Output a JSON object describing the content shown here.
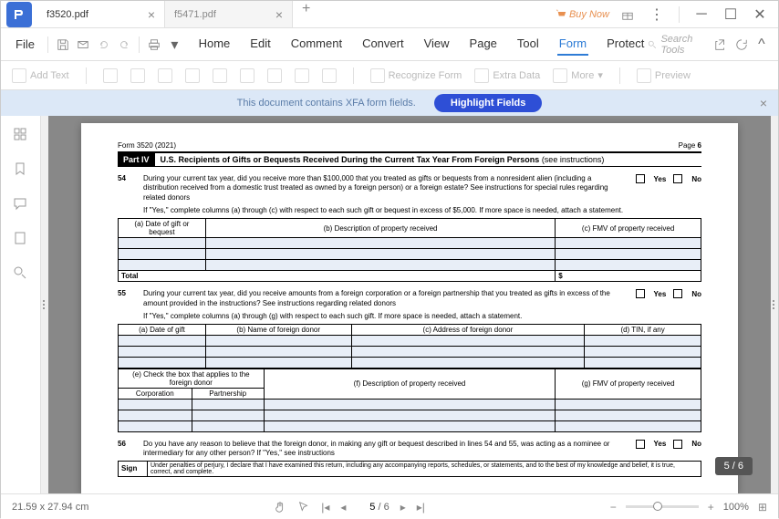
{
  "titlebar": {
    "tabs": [
      {
        "name": "f3520.pdf",
        "active": true
      },
      {
        "name": "f5471.pdf",
        "active": false
      }
    ],
    "buy_now": "Buy Now"
  },
  "menubar": {
    "file": "File",
    "tabs": [
      "Home",
      "Edit",
      "Comment",
      "Convert",
      "View",
      "Page",
      "Tool",
      "Form",
      "Protect"
    ],
    "active_tab": "Form",
    "search_placeholder": "Search Tools"
  },
  "toolbar": {
    "add_text": "Add Text",
    "recognize_form": "Recognize Form",
    "extra_data": "Extra Data",
    "more": "More",
    "preview": "Preview"
  },
  "xfa": {
    "message": "This document contains XFA form fields.",
    "button": "Highlight Fields"
  },
  "page": {
    "form_id": "Form 3520 (2021)",
    "page_label": "Page",
    "page_num": "6",
    "part_label": "Part IV",
    "part_title": "U.S. Recipients of Gifts or Bequests Received During the Current Tax Year From Foreign Persons",
    "part_suffix": "(see instructions)",
    "q54_num": "54",
    "q54_text": "During your current tax year, did you receive more than $100,000 that you treated as gifts or bequests from a nonresident alien (including a distribution received from a domestic trust treated as owned by a foreign person) or a foreign estate? See instructions for special rules regarding related donors",
    "yes": "Yes",
    "no": "No",
    "q54_sub": "If \"Yes,\" complete columns (a) through (c) with respect to each such gift or bequest in excess of $5,000. If more space is needed, attach a statement.",
    "tbl1_a": "(a)\nDate of gift or bequest",
    "tbl1_b": "(b)\nDescription of property received",
    "tbl1_c": "(c)\nFMV of property received",
    "total": "Total",
    "dollar": "$",
    "q55_num": "55",
    "q55_text": "During your current tax year, did you receive amounts from a foreign corporation or a foreign partnership that you treated as gifts in excess of the amount provided in the instructions? See instructions regarding related donors",
    "q55_sub": "If \"Yes,\" complete columns (a) through (g) with respect to each such gift. If more space is needed, attach a statement.",
    "tbl2_a": "(a)\nDate of gift",
    "tbl2_b": "(b)\nName of foreign donor",
    "tbl2_c": "(c)\nAddress of foreign donor",
    "tbl2_d": "(d)\nTIN, if any",
    "tbl2_e": "(e)\nCheck the box that applies to the foreign donor",
    "tbl2_e1": "Corporation",
    "tbl2_e2": "Partnership",
    "tbl2_f": "(f)\nDescription of property received",
    "tbl2_g": "(g)\nFMV of property received",
    "q56_num": "56",
    "q56_text": "Do you have any reason to believe that the foreign donor, in making any gift or bequest described in lines 54 and 55, was acting as a nominee or intermediary for any other person? If \"Yes,\" see instructions",
    "sign": "Sign",
    "perjury": "Under penalties of perjury, I declare that I have examined this return, including any accompanying reports, schedules, or statements, and to the best of my knowledge and belief, it is true, correct, and complete."
  },
  "badge": {
    "text": "5 / 6"
  },
  "statusbar": {
    "dimensions": "21.59 x 27.94 cm",
    "current_page": "5",
    "total_pages": "/ 6",
    "zoom": "100%"
  }
}
